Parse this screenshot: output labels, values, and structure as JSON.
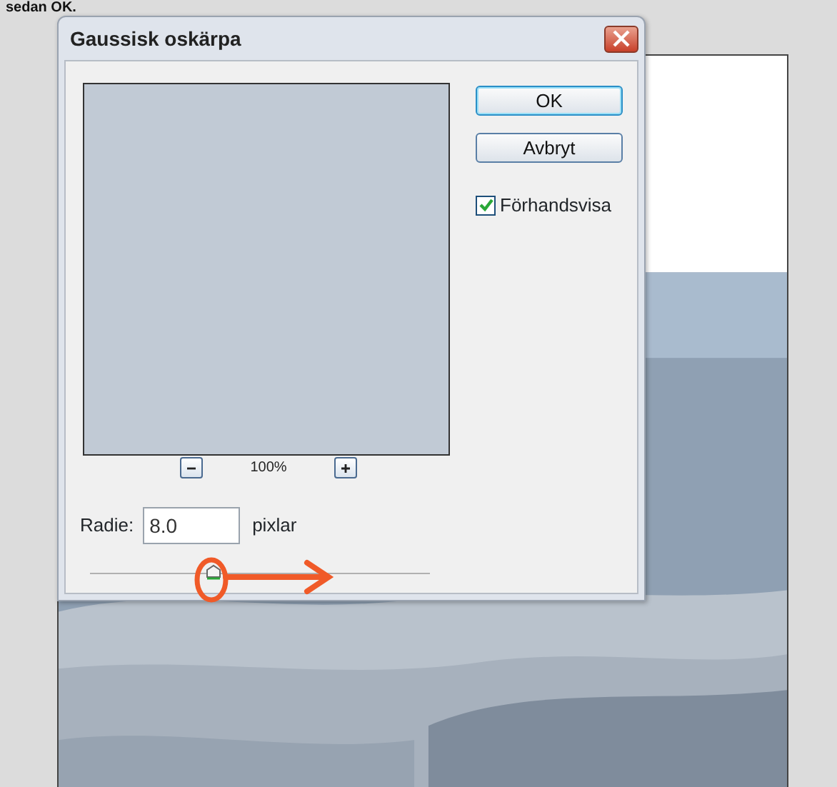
{
  "caption": "sedan OK.",
  "dialog": {
    "title": "Gaussisk oskärpa",
    "buttons": [
      {
        "label": "OK",
        "kind": "default"
      },
      {
        "label": "Avbryt",
        "kind": "normal"
      }
    ],
    "preview_checkbox": {
      "label": "Förhandsvisa",
      "checked": true
    },
    "zoom": {
      "text": "100%"
    },
    "radius": {
      "label": "Radie:",
      "value": "8.0",
      "unit": "pixlar",
      "level": 0.36
    }
  }
}
